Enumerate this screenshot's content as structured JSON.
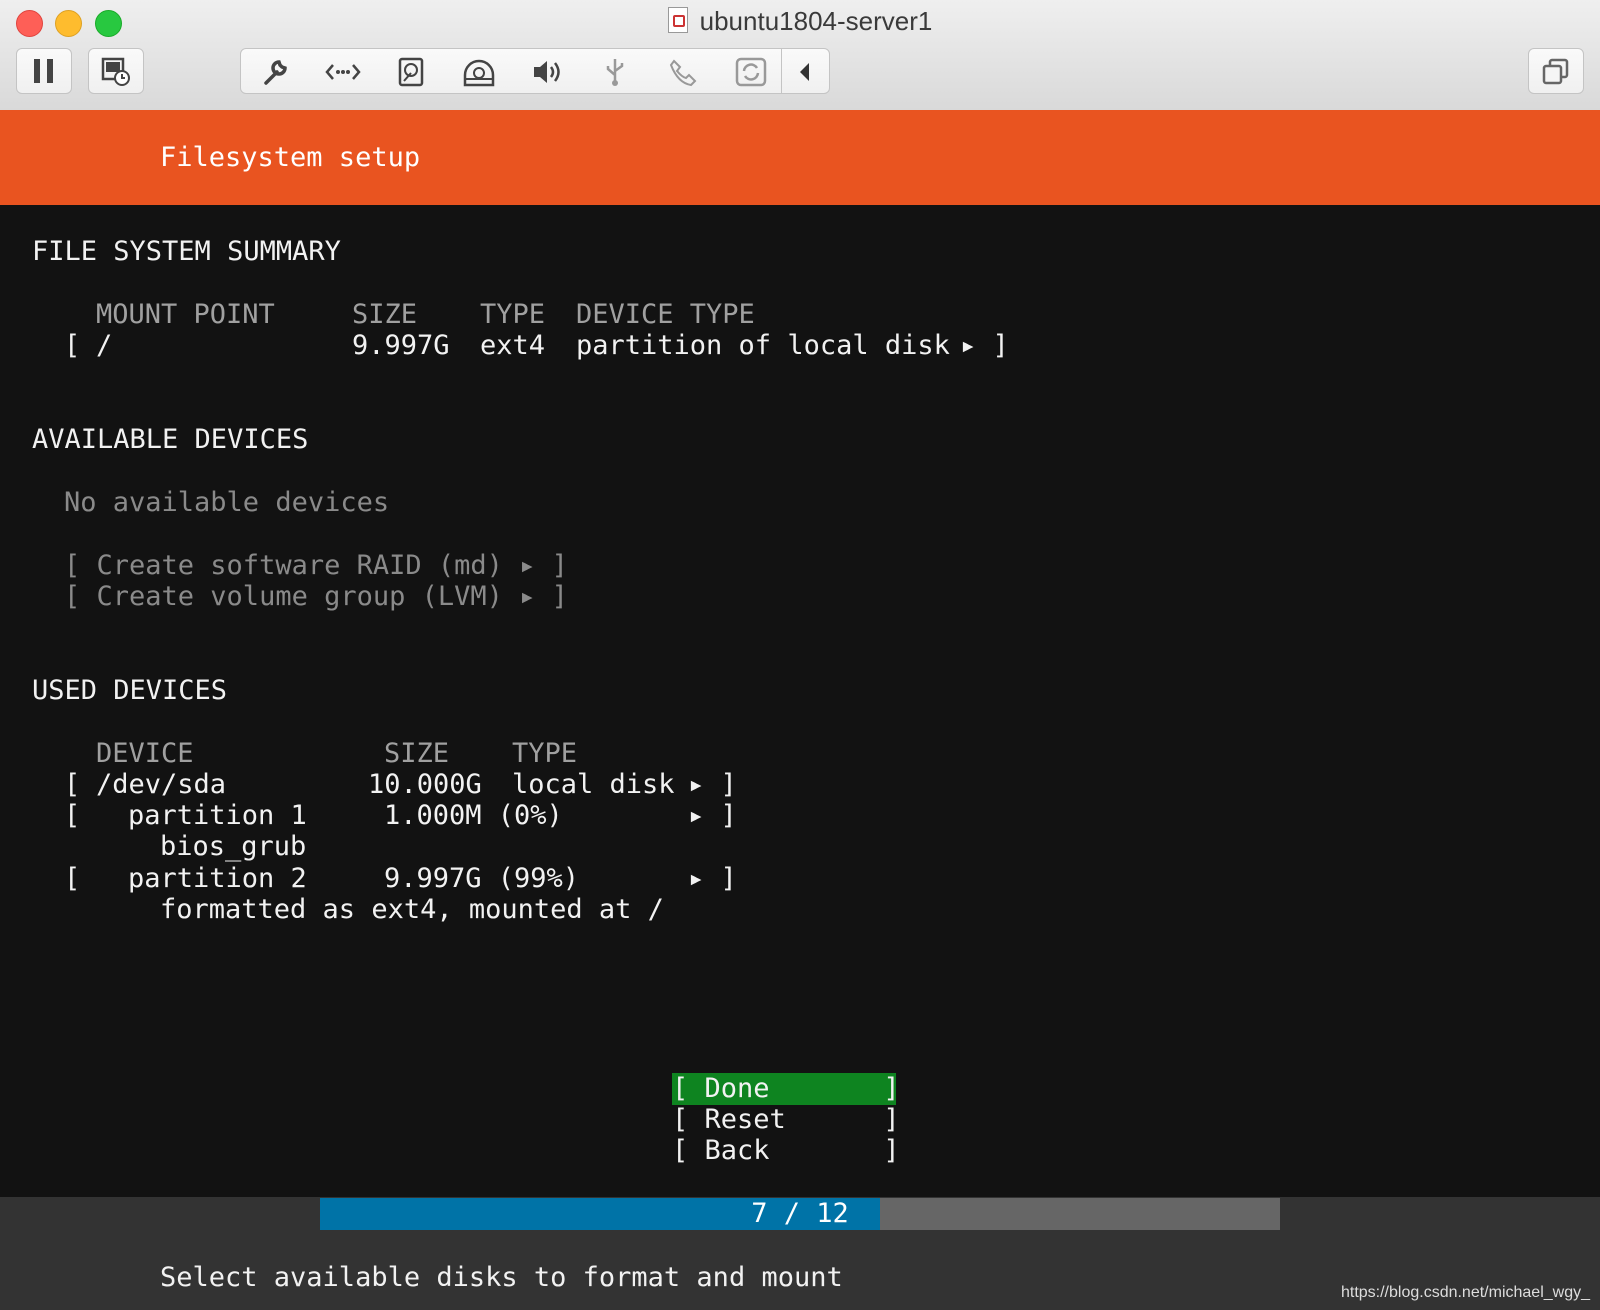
{
  "window": {
    "title": "ubuntu1804-server1"
  },
  "toolbar": {
    "left_icons": [
      "pause-icon",
      "snapshot-icon"
    ],
    "group_icons": [
      "wrench-icon",
      "network-icon",
      "hard-disk-icon",
      "optical-disk-icon",
      "sound-icon",
      "usb-icon",
      "camera-icon",
      "sync-icon",
      "collapse-arrow-icon"
    ],
    "right_icon": "restore-window-icon"
  },
  "installer": {
    "header": "Filesystem setup",
    "fs_summary": {
      "heading": "FILE SYSTEM SUMMARY",
      "columns": [
        "MOUNT POINT",
        "SIZE",
        "TYPE",
        "DEVICE TYPE"
      ],
      "row": {
        "open": "[",
        "mount": "/",
        "size": "9.997G",
        "type": "ext4",
        "device_type": "partition of local disk",
        "arrow": "▸ ]"
      }
    },
    "available": {
      "heading": "AVAILABLE DEVICES",
      "none": "No available devices",
      "raid": "[ Create software RAID (md) ▸ ]",
      "lvm": "[ Create volume group (LVM) ▸ ]"
    },
    "used": {
      "heading": "USED DEVICES",
      "columns": [
        "DEVICE",
        "SIZE",
        "TYPE"
      ],
      "rows": [
        {
          "open": "[",
          "device": "/dev/sda",
          "size": "10.000G",
          "type": "local disk",
          "arrow": "▸ ]"
        },
        {
          "open": "[",
          "device": "partition 1",
          "size": "1.000M (0%)",
          "type": "",
          "arrow": "▸ ]",
          "detail": "bios_grub"
        },
        {
          "open": "[",
          "device": "partition 2",
          "size": "9.997G (99%)",
          "type": "",
          "arrow": "▸ ]",
          "detail": "formatted as ext4, mounted at /"
        }
      ]
    },
    "buttons": {
      "done": "[ Done       ]",
      "reset": "[ Reset      ]",
      "back": "[ Back       ]"
    },
    "progress": {
      "text": "7 / 12",
      "current": 7,
      "total": 12
    },
    "footer": "Select available disks to format and mount"
  },
  "watermark": "https://blog.csdn.net/michael_wgy_"
}
